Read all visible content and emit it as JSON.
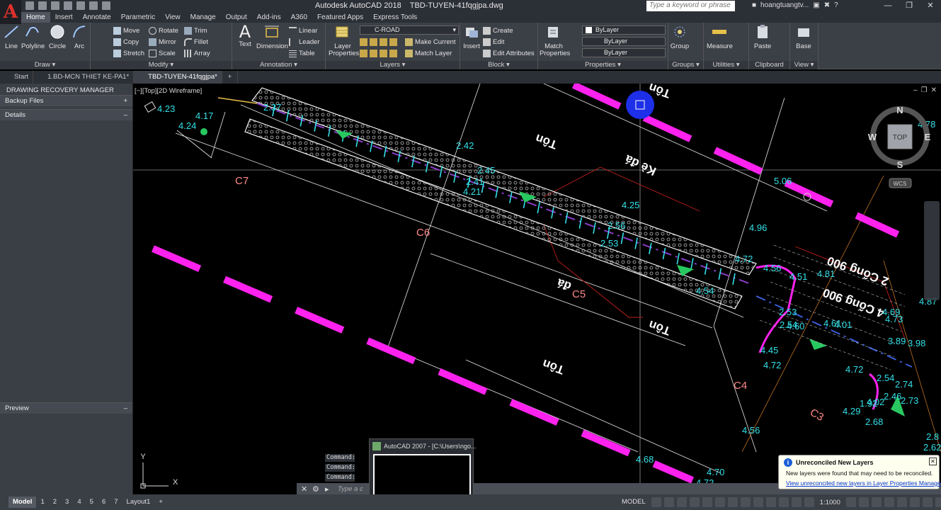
{
  "title_bar": {
    "app_title": "Autodesk AutoCAD 2018",
    "file_name": "TBD-TUYEN-41fqgjpa.dwg",
    "search_placeholder": "Type a keyword or phrase",
    "user_name": "hoangtuangtv..."
  },
  "ribbon_tabs": [
    "Home",
    "Insert",
    "Annotate",
    "Parametric",
    "View",
    "Manage",
    "Output",
    "Add-ins",
    "A360",
    "Featured Apps",
    "Express Tools"
  ],
  "panels": {
    "draw": {
      "title": "Draw",
      "big": [
        "Line",
        "Polyline",
        "Circle",
        "Arc"
      ]
    },
    "modify": {
      "title": "Modify",
      "small": [
        "Move",
        "Rotate",
        "Trim",
        "Copy",
        "Mirror",
        "Fillet",
        "Stretch",
        "Scale",
        "Array"
      ]
    },
    "annotation": {
      "title": "Annotation",
      "big": [
        "Text",
        "Dimension"
      ],
      "small": [
        "Linear",
        "Leader",
        "Table"
      ]
    },
    "layers": {
      "title": "Layers",
      "big_label_1": "Layer",
      "big_label_2": "Properties",
      "layer_name": "C-ROAD",
      "small": [
        "Make Current",
        "Match Layer"
      ]
    },
    "block": {
      "title": "Block",
      "big": "Insert",
      "small": [
        "Create",
        "Edit",
        "Edit Attributes"
      ]
    },
    "properties": {
      "title": "Properties",
      "big_label_1": "Match",
      "big_label_2": "Properties",
      "color": "ByLayer",
      "linetype": "ByLayer",
      "lineweight": "ByLayer"
    },
    "groups": {
      "title": "Groups",
      "big": "Group"
    },
    "utilities": {
      "title": "Utilities",
      "big": "Measure"
    },
    "clipboard": {
      "title": "Clipboard",
      "big": "Paste"
    },
    "view": {
      "title": "View",
      "big": "Base"
    }
  },
  "file_tabs": [
    "Start",
    "1.BD-MCN THIET KE-PA1*",
    "TBD-TUYEN-41fqgjpa*"
  ],
  "recovery": {
    "title": "DRAWING RECOVERY MANAGER",
    "backup_files": "Backup Files",
    "details": "Details",
    "preview": "Preview"
  },
  "viewport": {
    "label": "[−][Top][2D Wireframe]",
    "compass": {
      "n": "N",
      "s": "S",
      "e": "E",
      "w": "W",
      "top": "TOP",
      "wcs": "WCS"
    }
  },
  "drawing_texts": {
    "region_labels": [
      "C7",
      "C6",
      "C5",
      "C4",
      "C3"
    ],
    "ton": "Tôn",
    "ke_da": "Kè đá",
    "da": "đá",
    "cong_2": "2 Cống 900",
    "cong_4": "4 Cống 900",
    "elevations": [
      "4.23",
      "4.17",
      "4.24",
      "2.37",
      "2.42",
      "2.45",
      "2.41",
      "4.21",
      "4.25",
      "2.56",
      "2.53",
      "4.54",
      "4.96",
      "5.06",
      "4.72",
      "4.56",
      "4.51",
      "4.81",
      "2.53",
      "2.54",
      "4.60",
      "4.61",
      "4.01",
      "4.69",
      "4.73",
      "4.87",
      "4.78",
      "4.45",
      "4.72",
      "4.72",
      "4.56",
      "4.68",
      "4.70",
      "4.72",
      "3.89",
      "3.98",
      "2.74",
      "2.73",
      "2.68",
      "4.29",
      "1.92",
      "2.8",
      "2.62",
      "4.02",
      "2.46",
      "2.54"
    ]
  },
  "command": {
    "history": [
      "Command:",
      "Command:",
      "Command: _co"
    ],
    "placeholder": "Type a c"
  },
  "thumbnail": {
    "title": "AutoCAD 2007 - [C:\\Users\\ngo..."
  },
  "balloon": {
    "title": "Unreconciled New Layers",
    "body": "New layers were found that may need to be reconciled.",
    "link": "View unreconciled new layers in Layer Properties Manager"
  },
  "status": {
    "layout_tabs": [
      "Model",
      "1",
      "2",
      "3",
      "4",
      "5",
      "6",
      "7",
      "Layout1"
    ],
    "model": "MODEL",
    "scale": "1:1000"
  }
}
